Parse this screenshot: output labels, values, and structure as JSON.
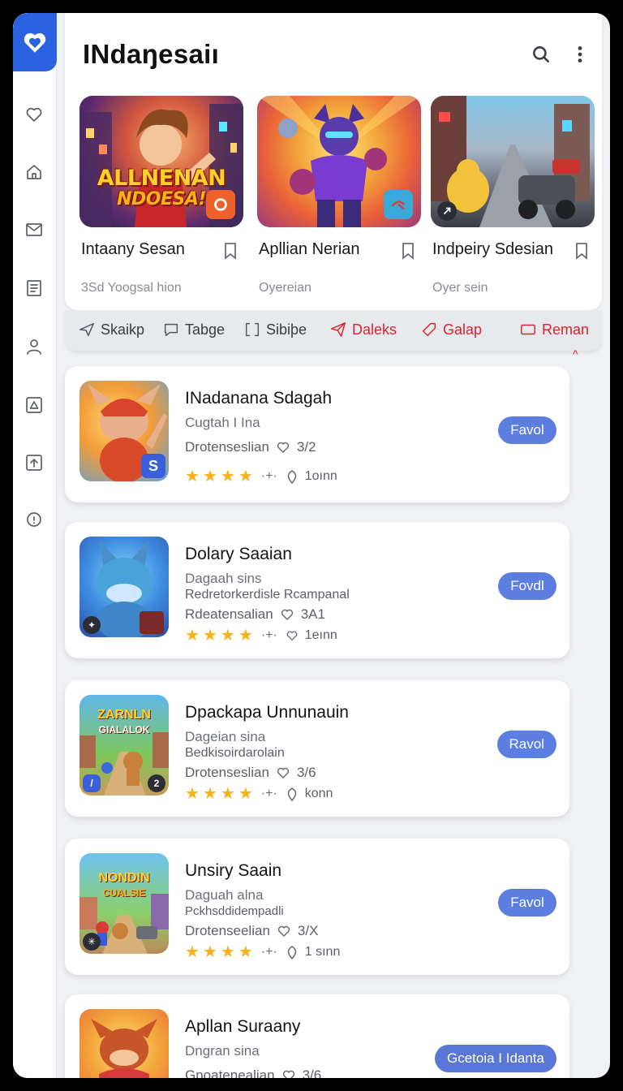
{
  "app": {
    "title": "INdaŋesaiı"
  },
  "featured": [
    {
      "name": "Intaany Sesan",
      "sub": "3Sd Yoogsal hion",
      "art_text_1": "ALLNENAN",
      "art_text_2": "NDOESA!"
    },
    {
      "name": "Apllian Nerian",
      "sub": "Oyereian"
    },
    {
      "name": "Indpeiry Sdesian",
      "sub": "Oyer sein"
    }
  ],
  "filters": [
    {
      "label": "Skaikp",
      "icon": "send-icon",
      "color": "#3a3c42"
    },
    {
      "label": "Tabge",
      "icon": "chat-bubble-icon",
      "color": "#3a3c42"
    },
    {
      "label": "Sibiþe",
      "icon": "square-bracket-icon",
      "color": "#3a3c42"
    },
    {
      "label": "Daleks",
      "icon": "paper-plane-icon",
      "color": "#d62430"
    },
    {
      "label": "Galap",
      "icon": "tag-icon",
      "color": "#d62430"
    },
    {
      "label": "Reman",
      "icon": "rectangle-icon",
      "color": "#d62430"
    }
  ],
  "filter_caret": "^",
  "apps": [
    {
      "title": "INadanana Sdagah",
      "sub": "Cugtah I Ina",
      "sub2": "",
      "meta_text": "Drotenseslian",
      "meta_count": "3/2",
      "rating_text": "1oınn",
      "button": "Favol",
      "stars": 4
    },
    {
      "title": "Dolary Saaian",
      "sub": "Dagaah sins",
      "sub2": "Redretorkerdisle Rcampanal",
      "meta_text": "Rdeatensalian",
      "meta_count": "3A1",
      "rating_text": "1eınn",
      "button": "Fovdl",
      "stars": 4
    },
    {
      "title": "Dpackapa Unnunauin",
      "sub": "Dageian sina",
      "sub2": "Bedkisoirdarolain",
      "meta_text": "Drotenseslian",
      "meta_count": "3/6",
      "rating_text": "konn",
      "button": "Ravol",
      "stars": 4
    },
    {
      "title": "Unsiry Saain",
      "sub": "Daguah alna",
      "sub2": "Pckhsddidempadli",
      "meta_text": "Drotenseelian",
      "meta_count": "3/X",
      "rating_text": "1 sınn",
      "button": "Favol",
      "stars": 4
    },
    {
      "title": "Apllan Suraany",
      "sub": "Dngran sina",
      "sub2": "",
      "meta_text": "Gnoatenealian",
      "meta_count": "3/6",
      "rating_text": "",
      "button": "Gcetoia I Idanta",
      "stars": 0
    }
  ],
  "thumb_text": {
    "app3_line1": "ZARNLN",
    "app3_line2": "GIALALOK",
    "app4_line1": "NONDIN",
    "app4_line2": "CUALSIE"
  },
  "colors": {
    "accent": "#2b62e0",
    "button": "#5b7ee0",
    "filter_active": "#d62430",
    "star": "#f6b21a"
  }
}
